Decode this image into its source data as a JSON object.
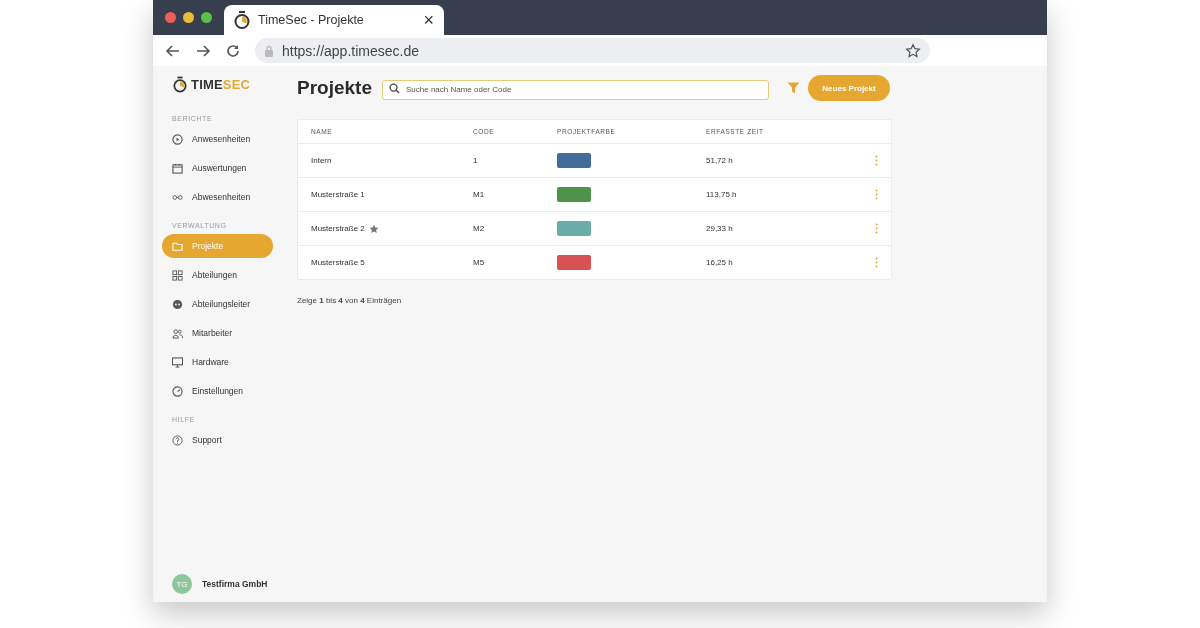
{
  "browser": {
    "tab_title": "TimeSec - Projekte",
    "tab_close": "×",
    "url": "https://app.timesec.de"
  },
  "logo": {
    "text": "TIME",
    "accent": "SEC"
  },
  "sidebar": {
    "sections": [
      {
        "title": "BERICHTE",
        "items": [
          {
            "label": "Anwesenheiten",
            "selected": false
          },
          {
            "label": "Auswertungen",
            "selected": false
          },
          {
            "label": "Abwesenheiten",
            "selected": false
          }
        ]
      },
      {
        "title": "VERWALTUNG",
        "items": [
          {
            "label": "Projekte",
            "selected": true
          },
          {
            "label": "Abteilungen",
            "selected": false
          },
          {
            "label": "Abteilungsleiter",
            "selected": false
          },
          {
            "label": "Mitarbeiter",
            "selected": false
          },
          {
            "label": "Hardware",
            "selected": false
          },
          {
            "label": "Einstellungen",
            "selected": false
          }
        ]
      },
      {
        "title": "HILFE",
        "items": [
          {
            "label": "Support",
            "selected": false
          }
        ]
      }
    ],
    "account": {
      "initials": "TG",
      "name": "Testfirma GmbH"
    }
  },
  "page": {
    "title": "Projekte",
    "search": {
      "placeholder": "Suche nach Name oder Code"
    },
    "new_button": "Neues Projekt"
  },
  "table": {
    "columns": [
      "NAME",
      "CODE",
      "PROJEKTFARBE",
      "ERFASSTE ZEIT"
    ],
    "rows": [
      {
        "name": "Intern",
        "starred": false,
        "code": "1",
        "color": "#456b9a",
        "time": "51,72 h"
      },
      {
        "name": "Musterstraße 1",
        "starred": false,
        "code": "M1",
        "color": "#4e934a",
        "time": "113,75 h"
      },
      {
        "name": "Musterstraße 2",
        "starred": true,
        "code": "M2",
        "color": "#6aaca6",
        "time": "29,33 h"
      },
      {
        "name": "Musterstraße 5",
        "starred": false,
        "code": "M5",
        "color": "#d95252",
        "time": "16,25 h"
      }
    ]
  },
  "footer": "Zeige **1** bis **4** von **4** Einträgen"
}
